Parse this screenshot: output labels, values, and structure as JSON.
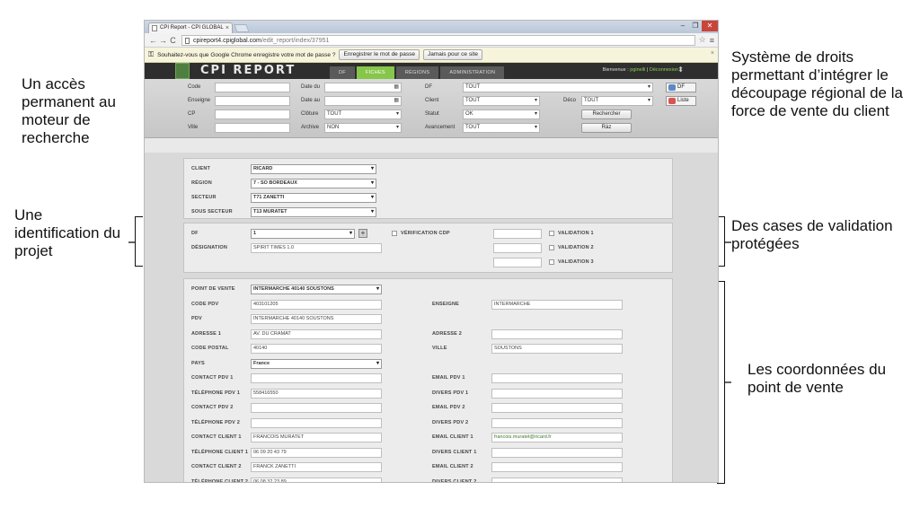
{
  "annotations": {
    "search": "Un accès permanent au moteur de recherche",
    "rights": "Système de droits permettant d’intégrer le découpage régional de la force de vente du client",
    "project": "Une identification du projet",
    "validation": "Des cases de validation protégées",
    "pos": "Les coordonnées du point de vente"
  },
  "browser": {
    "tab_title": "CPI Report - CPI GLOBAL",
    "tab_close": "×",
    "url_host": "cpireport4.cpiglobal.com",
    "url_path": "/edit_report/index/37951",
    "infobar_text": "Souhaitez-vous que Google Chrome enregistre votre mot de passe ?",
    "save_password": "Enregistrer le mot de passe",
    "never": "Jamais pour ce site"
  },
  "app": {
    "logo": "CPI REPORT",
    "tabs": [
      "DF",
      "FICHES",
      "RÉGIONS",
      "ADMINISTRATION"
    ],
    "active_tab": 1,
    "welcome_prefix": "Bienvenue :",
    "user": "pginelli",
    "logout": "Déconnexion"
  },
  "search": {
    "code": "Code",
    "enseigne": "Enseigne",
    "cp": "CP",
    "ville": "Ville",
    "date_du": "Date du",
    "date_au": "Date au",
    "cloture": "Clôture",
    "archive": "Archive",
    "df": "DF",
    "client": "Client",
    "statut": "Statut",
    "avancement": "Avancement",
    "deco": "Déco",
    "cloture_val": "TOUT",
    "archive_val": "NON",
    "df_val": "TOUT",
    "client_val": "TOUT",
    "statut_val": "OK",
    "avancement_val": "TOUT",
    "deco_val": "TOUT",
    "btn_search": "Rechercher",
    "btn_reset": "Ràz",
    "btn_df": "DF",
    "btn_list": "Liste"
  },
  "client_block": {
    "client_label": "CLIENT",
    "client_value": "RICARD",
    "region_label": "RÉGION",
    "region_value": "7 - SO BORDEAUX",
    "secteur_label": "SECTEUR",
    "secteur_value": "T71 ZANETTI",
    "sous_secteur_label": "SOUS SECTEUR",
    "sous_secteur_value": "T13 MURATET"
  },
  "project_block": {
    "df_label": "DF",
    "df_value": "1",
    "plus": "+",
    "designation_label": "DÉSIGNATION",
    "designation_value": "SPIRIT TIMES 1.0",
    "verif_label": "VÉRIFICATION CDP",
    "validation1": "VALIDATION 1",
    "validation2": "VALIDATION 2",
    "validation3": "VALIDATION 3"
  },
  "pos_block": {
    "left": [
      {
        "label": "POINT DE VENTE",
        "value": "INTERMARCHE 40140 SOUSTONS",
        "select": true
      },
      {
        "label": "CODE PDV",
        "value": "403101205"
      },
      {
        "label": "PDV",
        "value": "INTERMARCHE 40140 SOUSTONS"
      },
      {
        "label": "ADRESSE 1",
        "value": "AV. DU CRAMAT"
      },
      {
        "label": "CODE POSTAL",
        "value": "40140"
      },
      {
        "label": "PAYS",
        "value": "France",
        "select": true
      },
      {
        "label": "CONTACT PDV 1",
        "value": ""
      },
      {
        "label": "TÉLÉPHONE PDV 1",
        "value": "558416550"
      },
      {
        "label": "CONTACT PDV 2",
        "value": ""
      },
      {
        "label": "TÉLÉPHONE PDV 2",
        "value": ""
      },
      {
        "label": "CONTACT CLIENT 1",
        "value": "FRANCOIS MURATET"
      },
      {
        "label": "TÉLÉPHONE CLIENT 1",
        "value": "06 09 20 43 79"
      },
      {
        "label": "CONTACT CLIENT 2",
        "value": "FRANCK ZANETTI"
      },
      {
        "label": "TÉLÉPHONE CLIENT 2",
        "value": "06 08 32 23 89"
      }
    ],
    "right": [
      {
        "row": 1,
        "label": "ENSEIGNE",
        "value": "INTERMARCHE"
      },
      {
        "row": 3,
        "label": "ADRESSE 2",
        "value": ""
      },
      {
        "row": 4,
        "label": "VILLE",
        "value": "SOUSTONS"
      },
      {
        "row": 6,
        "label": "EMAIL PDV 1",
        "value": ""
      },
      {
        "row": 7,
        "label": "DIVERS PDV 1",
        "value": ""
      },
      {
        "row": 8,
        "label": "EMAIL PDV 2",
        "value": ""
      },
      {
        "row": 9,
        "label": "DIVERS PDV 2",
        "value": ""
      },
      {
        "row": 10,
        "label": "EMAIL CLIENT 1",
        "value": "francois.muratet@ricard.fr",
        "mail": true
      },
      {
        "row": 11,
        "label": "DIVERS CLIENT 1",
        "value": ""
      },
      {
        "row": 12,
        "label": "EMAIL CLIENT 2",
        "value": ""
      },
      {
        "row": 13,
        "label": "DIVERS CLIENT 2",
        "value": ""
      }
    ]
  }
}
